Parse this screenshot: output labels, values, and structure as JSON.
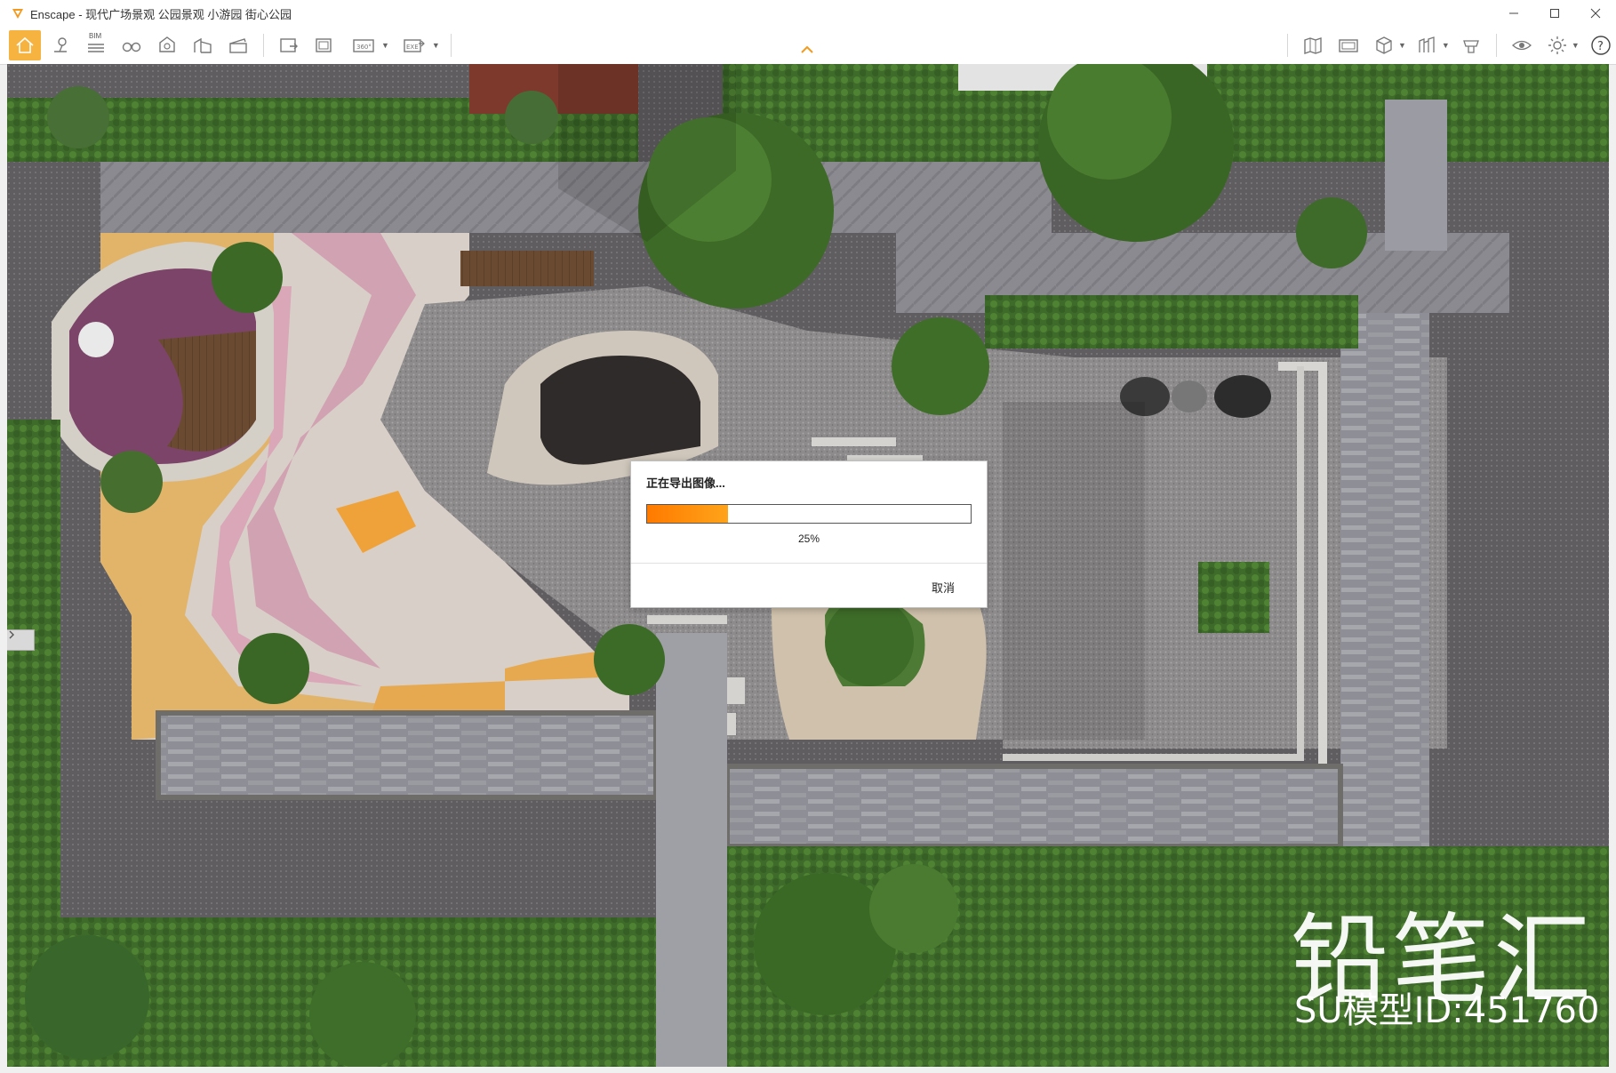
{
  "window": {
    "title": "Enscape - 现代广场景观 公园景观 小游园 街心公园"
  },
  "toolbar": {
    "bim_label": "BIM",
    "panorama_label": "360°",
    "exe_label": "EXE",
    "icons_left": [
      "home-icon",
      "location-pin-icon",
      "bim-icon",
      "binoculars-icon",
      "section-box-icon",
      "buildings-icon",
      "clapperboard-icon"
    ],
    "icons_export": [
      "screenshot-export-icon",
      "batch-render-icon",
      "panorama-icon",
      "standalone-export-icon"
    ],
    "icons_right": [
      "map-icon",
      "asset-library-icon",
      "cube-view-icon",
      "site-context-icon",
      "material-editor-icon",
      "visual-settings-icon",
      "settings-icon",
      "help-icon"
    ]
  },
  "dialog": {
    "title": "正在导出图像...",
    "progress": 0.25,
    "progress_text": "25%",
    "cancel_label": "取消"
  },
  "watermark": {
    "brand": "铅笔汇",
    "model_id": "SU模型ID:451760"
  },
  "colors": {
    "accent": "#f7b340",
    "progress_start": "#ff7a00",
    "progress_end": "#ffa41a"
  }
}
